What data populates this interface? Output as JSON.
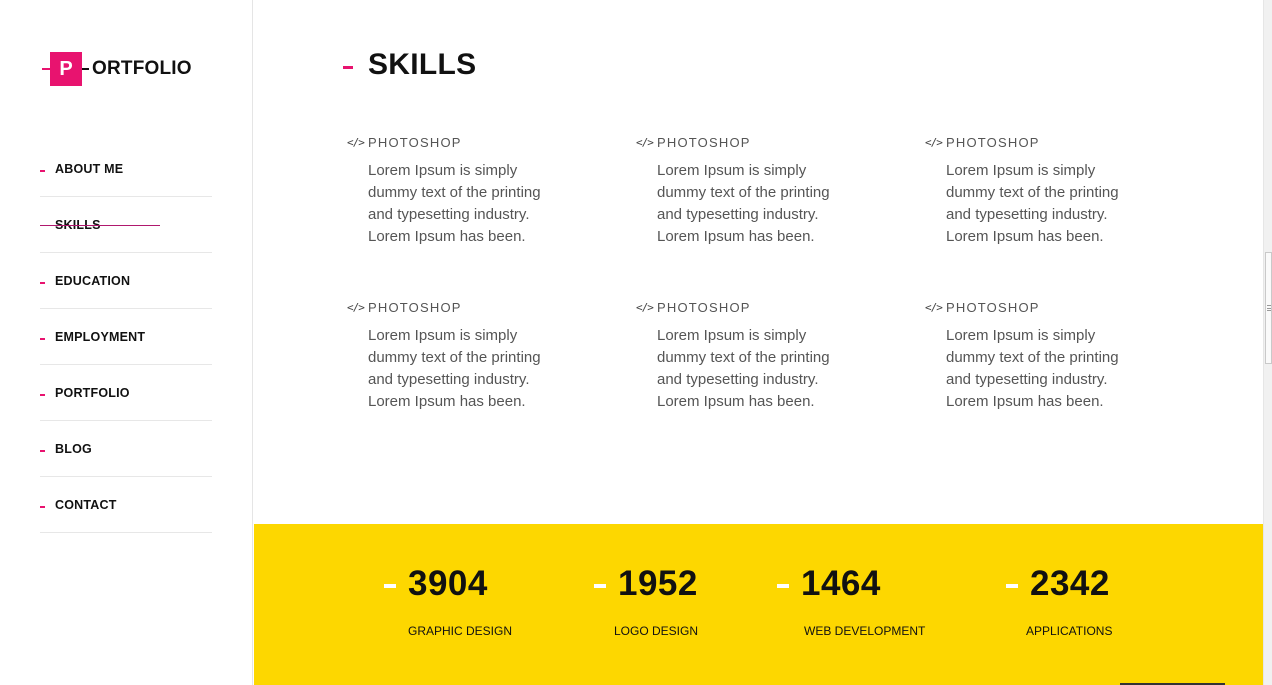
{
  "logo": {
    "initial": "P",
    "text": "ORTFOLIO"
  },
  "nav": [
    {
      "label": "ABOUT ME",
      "active": false
    },
    {
      "label": "SKILLS",
      "active": true
    },
    {
      "label": "EDUCATION",
      "active": false
    },
    {
      "label": "EMPLOYMENT",
      "active": false
    },
    {
      "label": "PORTFOLIO",
      "active": false
    },
    {
      "label": "BLOG",
      "active": false
    },
    {
      "label": "CONTACT",
      "active": false
    }
  ],
  "section": {
    "title": "SKILLS"
  },
  "skills": [
    {
      "icon": "code-icon",
      "icon_glyph": "</>",
      "name": "PHOTOSHOP",
      "description": "Lorem Ipsum is simply dummy text of the printing and typesetting industry. Lorem Ipsum has been."
    },
    {
      "icon": "code-icon",
      "icon_glyph": "</>",
      "name": "PHOTOSHOP",
      "description": "Lorem Ipsum is simply dummy text of the printing and typesetting industry. Lorem Ipsum has been."
    },
    {
      "icon": "code-icon",
      "icon_glyph": "</>",
      "name": "PHOTOSHOP",
      "description": "Lorem Ipsum is simply dummy text of the printing and typesetting industry. Lorem Ipsum has been."
    },
    {
      "icon": "code-icon",
      "icon_glyph": "</>",
      "name": "PHOTOSHOP",
      "description": "Lorem Ipsum is simply dummy text of the printing and typesetting industry. Lorem Ipsum has been."
    },
    {
      "icon": "code-icon",
      "icon_glyph": "</>",
      "name": "PHOTOSHOP",
      "description": "Lorem Ipsum is simply dummy text of the printing and typesetting industry. Lorem Ipsum has been."
    },
    {
      "icon": "code-icon",
      "icon_glyph": "</>",
      "name": "PHOTOSHOP",
      "description": "Lorem Ipsum is simply dummy text of the printing and typesetting industry. Lorem Ipsum has been."
    }
  ],
  "stats": [
    {
      "value": "3904",
      "label": "GRAPHIC DESIGN"
    },
    {
      "value": "1952",
      "label": "LOGO DESIGN"
    },
    {
      "value": "1464",
      "label": "WEB DEVELOPMENT"
    },
    {
      "value": "2342",
      "label": "APPLICATIONS"
    }
  ],
  "colors": {
    "accent": "#e8136f",
    "stats_band": "#fdd700",
    "text": "#111111",
    "muted": "#555555"
  }
}
